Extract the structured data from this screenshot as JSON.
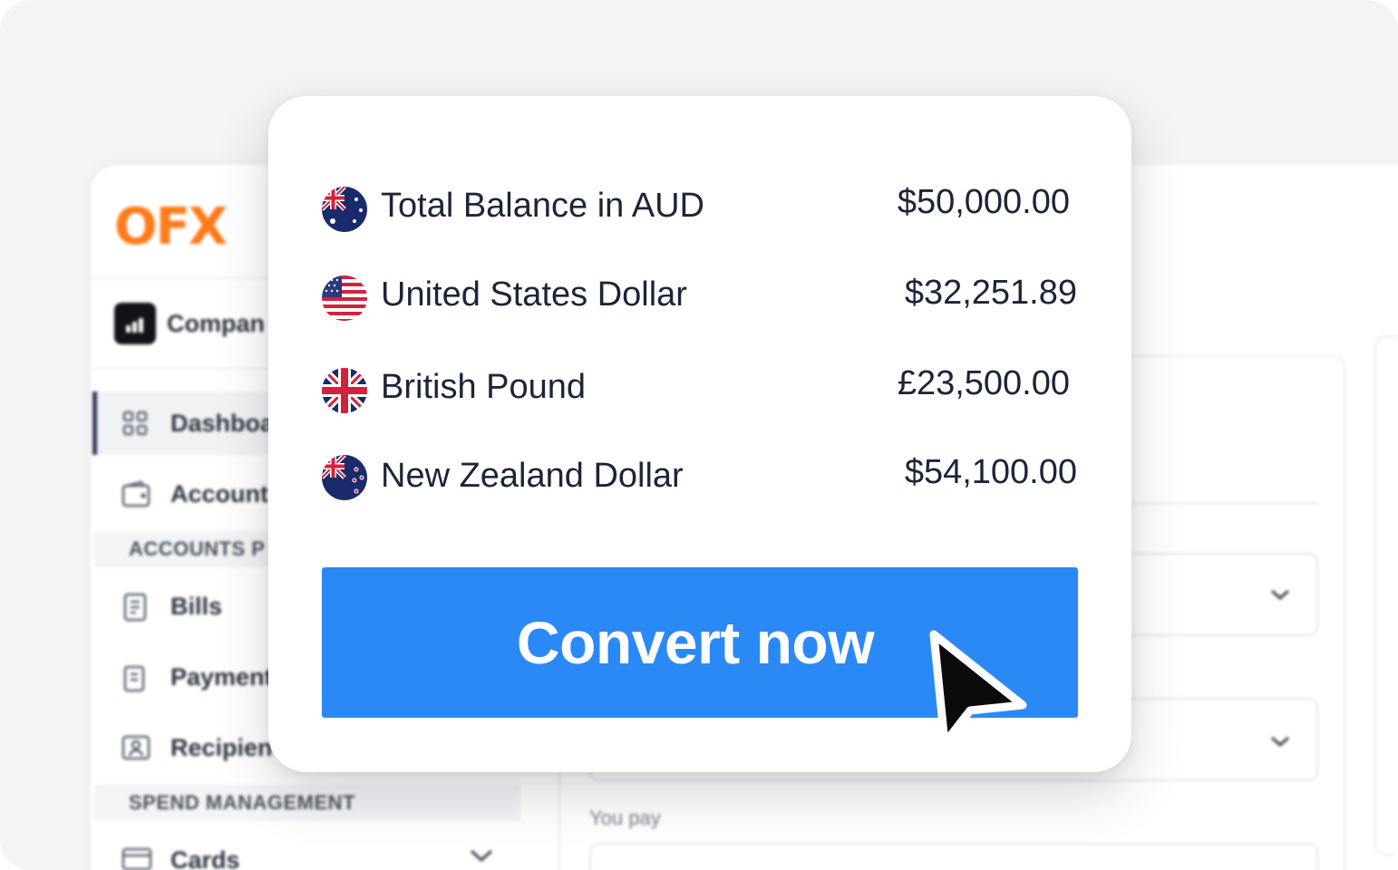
{
  "sidebar": {
    "logo_text": "OFX",
    "company_label": "Compan",
    "items": [
      {
        "label": "Dashboa",
        "icon": "grid-icon"
      },
      {
        "label": "Account",
        "icon": "wallet-icon"
      },
      {
        "label": "Bills",
        "icon": "bill-icon"
      },
      {
        "label": "Payment",
        "icon": "payment-icon"
      },
      {
        "label": "Recipien",
        "icon": "recipient-icon"
      },
      {
        "label": "Cards",
        "icon": "card-icon"
      }
    ],
    "sections": [
      "ACCOUNTS P",
      "SPEND MANAGEMENT"
    ]
  },
  "main": {
    "you_pay_label": "You pay"
  },
  "popup": {
    "rows": [
      {
        "flag": "australia-flag-icon",
        "label": "Total Balance in AUD",
        "value": "$50,000.00"
      },
      {
        "flag": "usa-flag-icon",
        "label": "United States Dollar",
        "value": "$32,251.89"
      },
      {
        "flag": "uk-flag-icon",
        "label": "British Pound",
        "value": "£23,500.00"
      },
      {
        "flag": "new-zealand-flag-icon",
        "label": "New Zealand Dollar",
        "value": "$54,100.00"
      }
    ],
    "convert_label": "Convert now"
  },
  "colors": {
    "brand_orange": "#ff7a1a",
    "button_blue": "#2b89f5",
    "text_dark": "#1c2438"
  }
}
